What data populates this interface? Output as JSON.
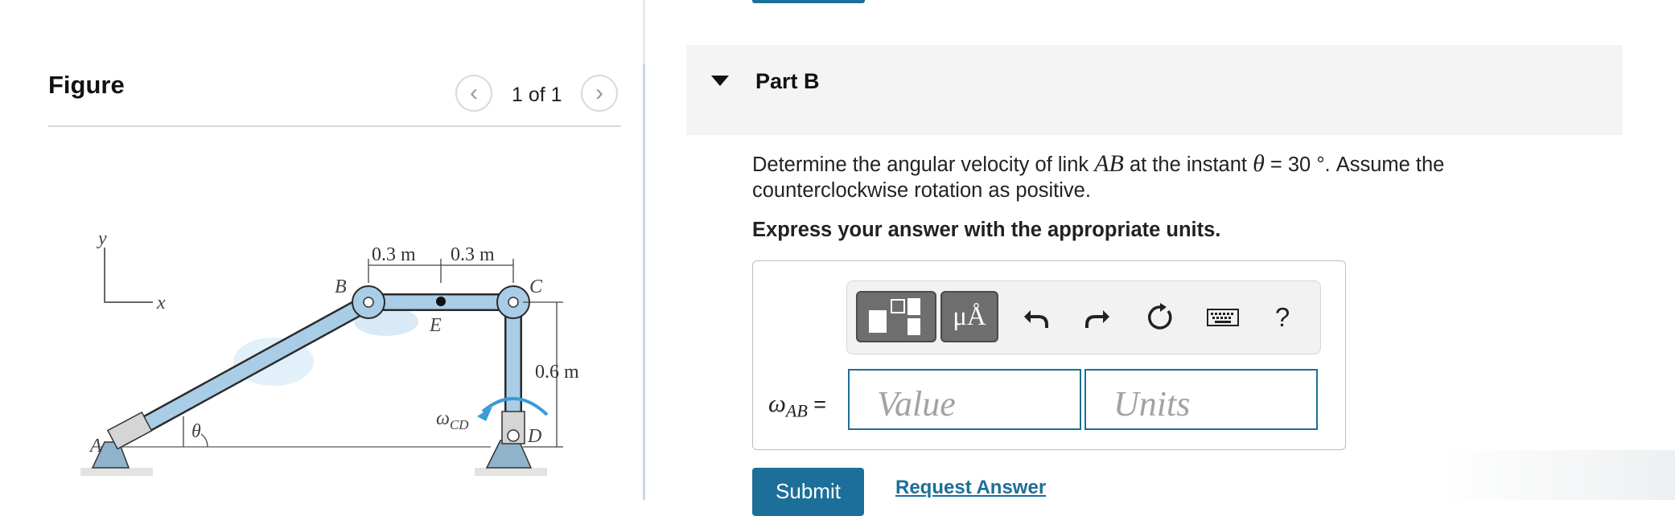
{
  "figure_panel": {
    "title": "Figure",
    "pagination": {
      "current": "1 of 1",
      "prev_icon": "chevron-left-icon",
      "next_icon": "chevron-right-icon"
    },
    "diagram": {
      "axis_labels": {
        "y": "y",
        "x": "x"
      },
      "points": {
        "A": "A",
        "B": "B",
        "C": "C",
        "D": "D",
        "E": "E"
      },
      "dimensions": {
        "dim1": "0.3 m",
        "dim2": "0.3 m",
        "dim3": "0.6 m"
      },
      "angle": "θ",
      "omega_cd_symbol": "ω",
      "omega_cd_sub": "CD",
      "colors": {
        "link": "#a9cde6",
        "link_edge": "#2b2b2b",
        "support": "#8fb3cb",
        "arrow": "#3a9bd5"
      }
    }
  },
  "part": {
    "toggle_icon": "caret-down-icon",
    "title": "Part B",
    "question_pre": "Determine the angular velocity of link ",
    "question_var": "AB",
    "question_mid": " at the instant ",
    "question_theta": "θ",
    "question_post": " = 30 °. Assume the counterclockwise rotation as positive.",
    "instruction": "Express your answer with the appropriate units."
  },
  "toolbar": {
    "templates_icon": "templates-icon",
    "units_label": "μÅ",
    "undo_icon": "undo-icon",
    "redo_icon": "redo-icon",
    "reset_icon": "reset-icon",
    "keyboard_icon": "keyboard-icon",
    "help_label": "?"
  },
  "answer": {
    "label_symbol": "ω",
    "label_sub": "AB",
    "equals": "=",
    "value_placeholder": "Value",
    "units_placeholder": "Units"
  },
  "actions": {
    "submit": "Submit",
    "request": "Request Answer"
  },
  "colors": {
    "accent": "#1c6f98",
    "header_bg": "#f4f4f4"
  }
}
